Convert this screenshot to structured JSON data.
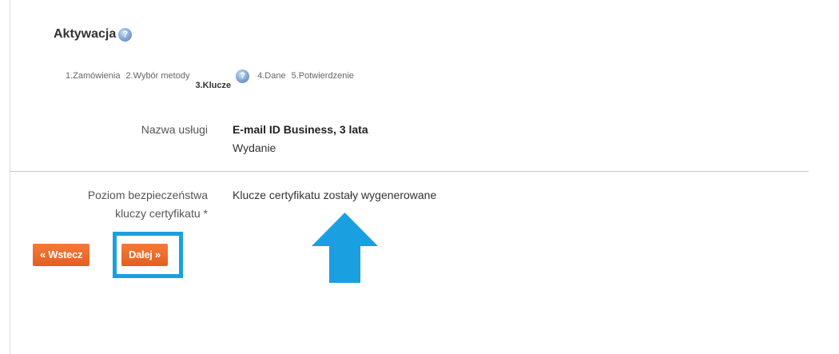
{
  "header": {
    "title": "Aktywacja",
    "help_icon": "question-help-icon"
  },
  "steps": [
    {
      "label": "1.Zamówienia"
    },
    {
      "label": "2.Wybór metody"
    },
    {
      "label": "3.Klucze"
    },
    {
      "label": "4.Dane"
    },
    {
      "label": "5.Potwierdzenie"
    }
  ],
  "active_step": 3,
  "service": {
    "label": "Nazwa usługi",
    "name": "E-mail ID Business, 3 lata",
    "type": "Wydanie"
  },
  "security": {
    "label_line1": "Poziom bezpieczeństwa",
    "label_line2": "kluczy certyfikatu *",
    "value": "Klucze certyfikatu zostały wygenerowane"
  },
  "buttons": {
    "back_label": "« Wstecz",
    "next_label": "Dalej »"
  },
  "colors": {
    "button_orange": "#e8682a",
    "highlight_blue": "#1aa0e0",
    "arrow_blue": "#1aa0e0",
    "help_icon_blue": "#7fa3d1"
  }
}
